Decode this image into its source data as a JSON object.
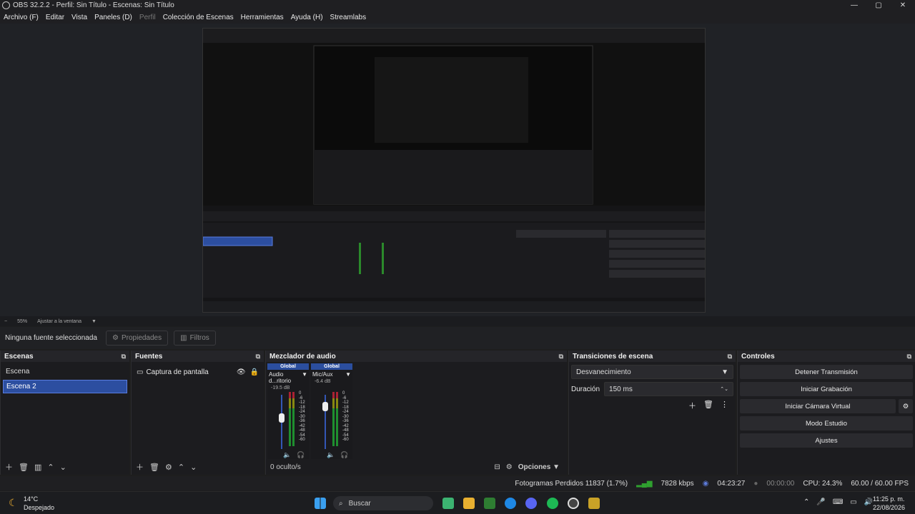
{
  "window": {
    "title": "OBS 32.2.2 - Perfil: Sin Título - Escenas: Sin Título",
    "controls": [
      "—",
      "▢",
      "✕"
    ]
  },
  "menu": [
    "Archivo (F)",
    "Editar",
    "Vista",
    "Paneles (D)",
    "Perfil",
    "Colección de Escenas",
    "Herramientas",
    "Ayuda (H)",
    "Streamlabs"
  ],
  "zoom": {
    "level": "55%",
    "fit": "Ajustar a la ventana"
  },
  "source_toolbar": {
    "none_selected": "Ninguna fuente seleccionada",
    "properties": "Propiedades",
    "filters": "Filtros"
  },
  "scenes": {
    "title": "Escenas",
    "items": [
      "Escena",
      "Escena 2"
    ],
    "selected_index": 1
  },
  "sources": {
    "title": "Fuentes",
    "items": [
      "Captura de pantalla"
    ]
  },
  "mixer": {
    "title": "Mezclador de audio",
    "channels": [
      {
        "scope": "Global",
        "name": "Audio d...ritorio",
        "db": "-19.5 dB"
      },
      {
        "scope": "Global",
        "name": "Mic/Aux",
        "db": "-6.4 dB"
      }
    ],
    "scale": [
      "0",
      "-6",
      "-12",
      "-18",
      "-24",
      "-30",
      "-36",
      "-42",
      "-48",
      "-54",
      "-60"
    ],
    "hidden": "0 oculto/s",
    "options": "Opciones"
  },
  "transitions": {
    "title": "Transiciones de escena",
    "type": "Desvanecimiento",
    "duration_label": "Duración",
    "duration_value": "150 ms"
  },
  "controls": {
    "title": "Controles",
    "buttons": [
      "Detener Transmisión",
      "Iniciar Grabación",
      "Iniciar Cámara Virtual",
      "Modo Estudio",
      "Ajustes"
    ]
  },
  "status": {
    "dropped": "Fotogramas Perdidos 11837 (1.7%)",
    "bitrate": "7828 kbps",
    "stream_time": "04:23:27",
    "rec_time": "00:00:00",
    "cpu": "CPU: 24.3%",
    "fps": "60.00 / 60.00 FPS"
  },
  "taskbar": {
    "temp": "14°C",
    "weather": "Despejado",
    "search": "Buscar",
    "time": "11:25 p. m.",
    "date": "22/08/2026"
  },
  "colors": {
    "accent": "#2c4ea0",
    "panel": "#1c1c1f",
    "header": "#252529"
  }
}
